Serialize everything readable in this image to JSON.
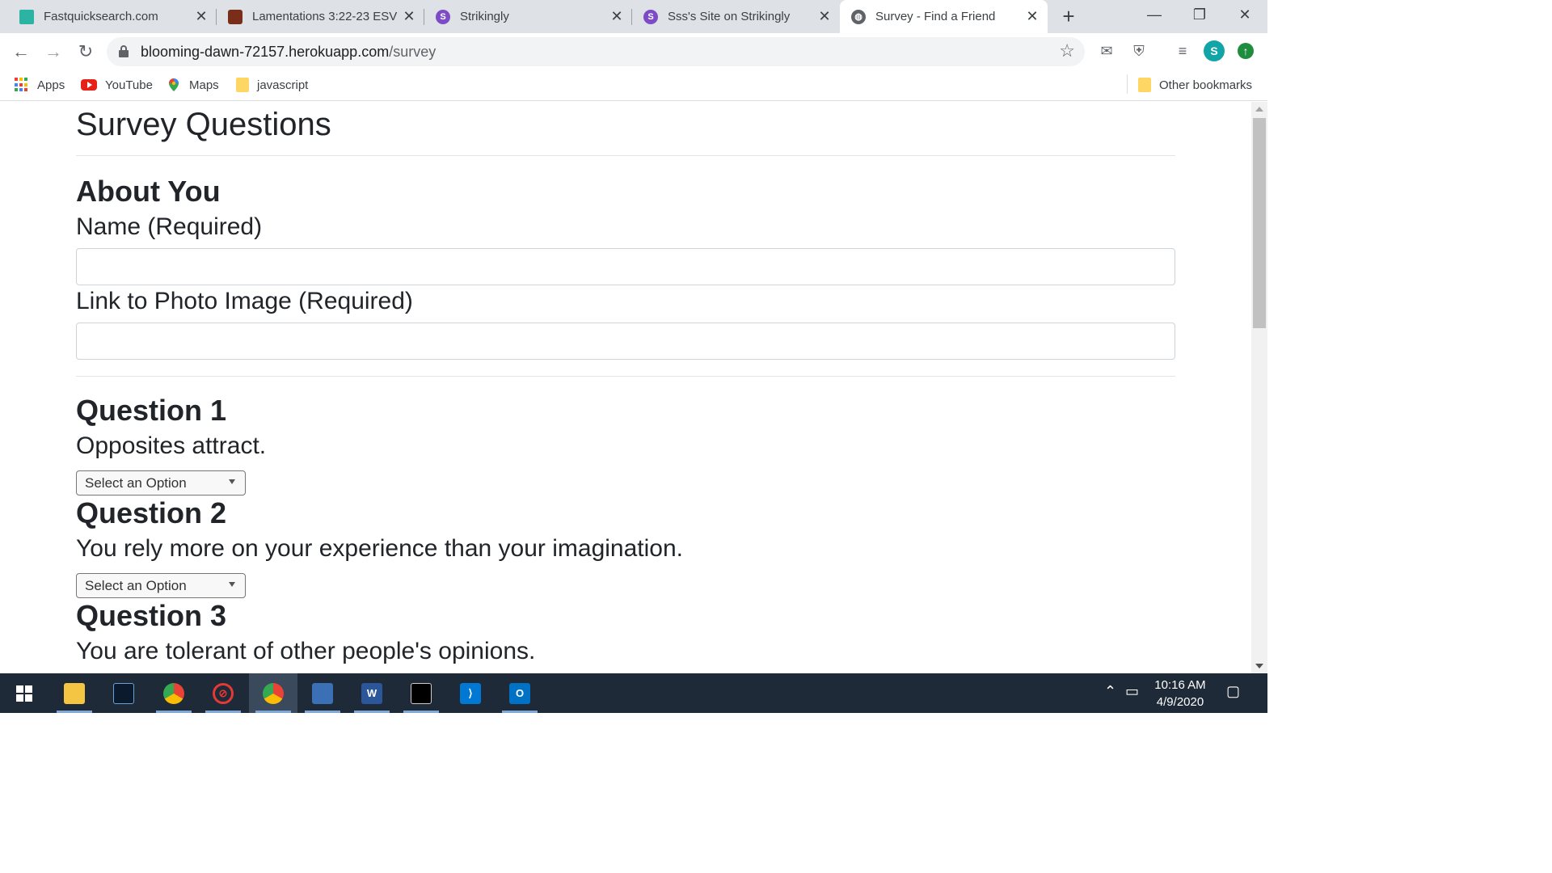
{
  "browser": {
    "tabs": [
      {
        "title": "Fastquicksearch.com",
        "favicon": "list-icon",
        "color": "#2bb3a3"
      },
      {
        "title": "Lamentations 3:22-23 ESV -",
        "favicon": "bible-icon",
        "color": "#7a2e1a"
      },
      {
        "title": "Strikingly",
        "favicon": "strikingly-icon",
        "color": "#7d4bc5",
        "letter": "S"
      },
      {
        "title": "Sss's Site on Strikingly",
        "favicon": "strikingly-icon",
        "color": "#7d4bc5",
        "letter": "S"
      },
      {
        "title": "Survey - Find a Friend",
        "favicon": "globe-icon",
        "color": "#5f6368",
        "active": true
      }
    ],
    "url_host": "blooming-dawn-72157.herokuapp.com",
    "url_path": "/survey",
    "profile_letter": "S",
    "bookmarks": [
      {
        "label": "Apps",
        "icon": "apps-grid-icon"
      },
      {
        "label": "YouTube",
        "icon": "youtube-icon"
      },
      {
        "label": "Maps",
        "icon": "maps-pin-icon"
      },
      {
        "label": "javascript",
        "icon": "folder-icon"
      }
    ],
    "other_bookmarks": "Other bookmarks"
  },
  "page": {
    "title": "Survey Questions",
    "about_heading": "About You",
    "name_label": "Name (Required)",
    "name_value": "",
    "photo_label": "Link to Photo Image (Required)",
    "photo_value": "",
    "questions": [
      {
        "title": "Question 1",
        "text": "Opposites attract.",
        "selected": "Select an Option"
      },
      {
        "title": "Question 2",
        "text": "You rely more on your experience than your imagination.",
        "selected": "Select an Option"
      },
      {
        "title": "Question 3",
        "text": "You are tolerant of other people's opinions."
      }
    ]
  },
  "taskbar": {
    "time": "10:16 AM",
    "date": "4/9/2020",
    "apps": [
      "file-explorer-icon",
      "laptop-app-icon",
      "chrome-icon",
      "blocked-icon",
      "chrome-profile-icon",
      "app-icon",
      "word-icon",
      "terminal-icon",
      "vscode-icon",
      "outlook-icon"
    ]
  },
  "colors": {
    "tabstrip": "#dee1e6",
    "taskbar": "#1e2a38",
    "profile": "#12a4a6"
  }
}
